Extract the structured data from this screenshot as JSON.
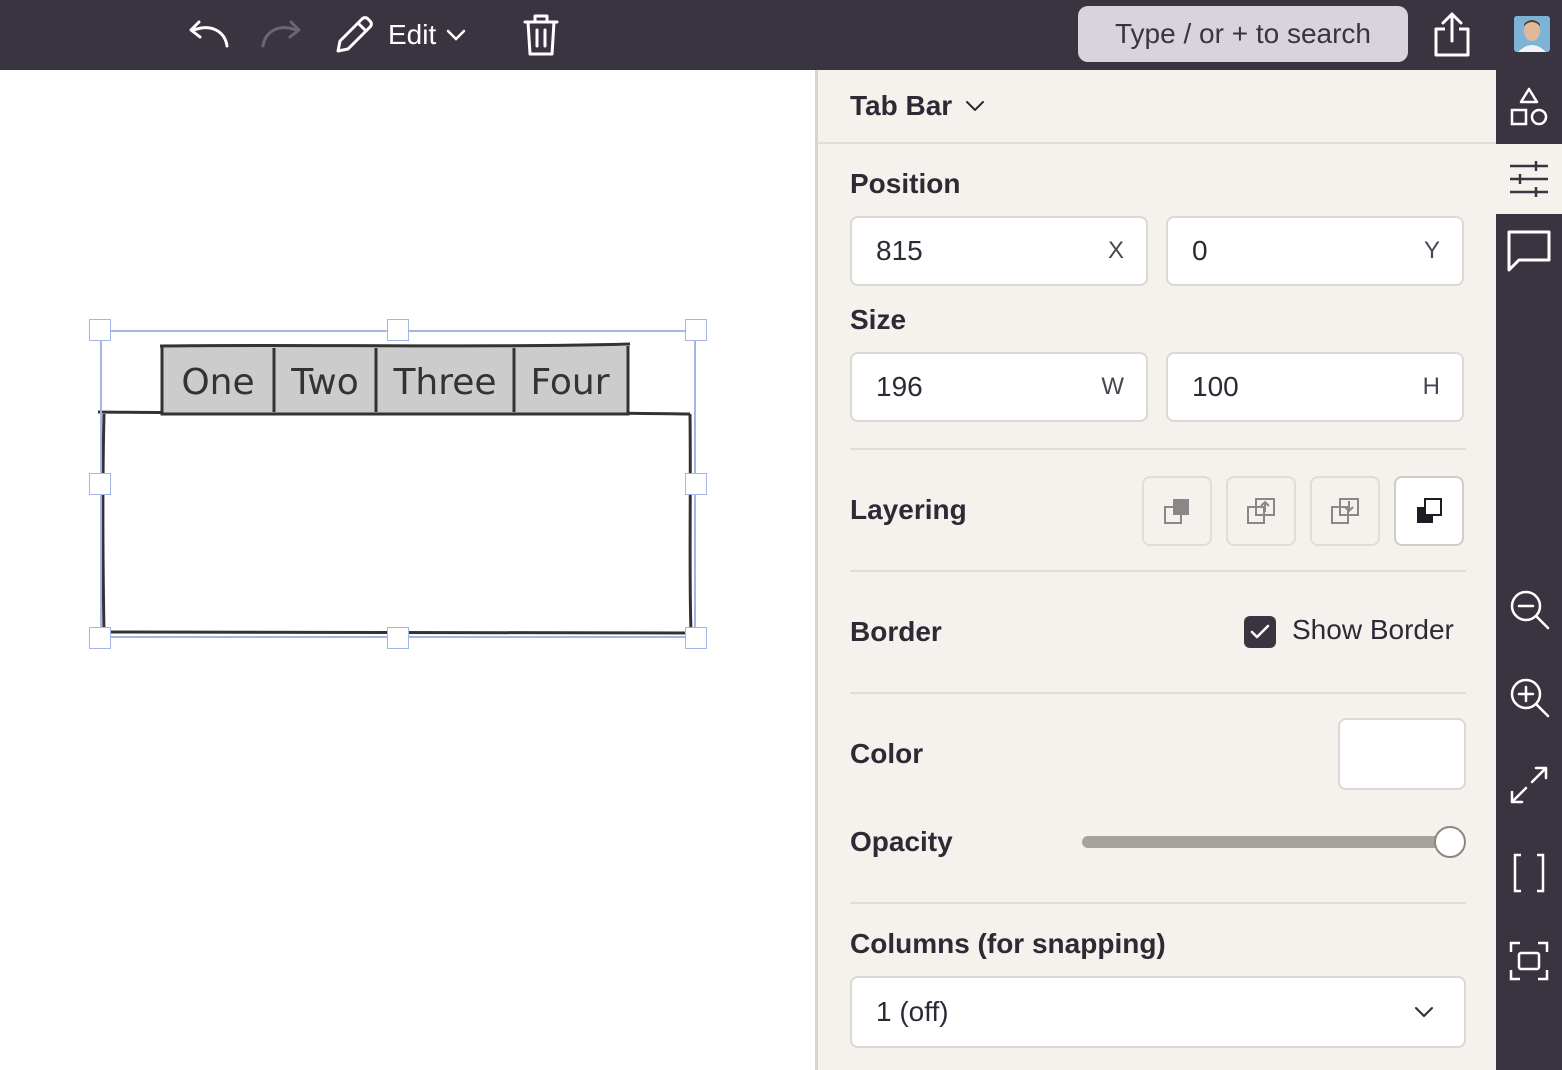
{
  "toolbar": {
    "edit_label": "Edit",
    "search_placeholder": "Type / or + to search"
  },
  "canvas": {
    "tab_bar": {
      "tabs": [
        "One",
        "Two",
        "Three",
        "Four"
      ]
    }
  },
  "panel": {
    "title": "Tab Bar",
    "position": {
      "label": "Position",
      "x": {
        "value": "815",
        "unit": "X"
      },
      "y": {
        "value": "0",
        "unit": "Y"
      }
    },
    "size": {
      "label": "Size",
      "w": {
        "value": "196",
        "unit": "W"
      },
      "h": {
        "value": "100",
        "unit": "H"
      }
    },
    "layering": {
      "label": "Layering"
    },
    "border": {
      "label": "Border",
      "show_border_label": "Show Border",
      "show_border_checked": true
    },
    "color": {
      "label": "Color",
      "value": "#ffffff"
    },
    "opacity": {
      "label": "Opacity",
      "value": 1.0
    },
    "columns": {
      "label": "Columns (for snapping)",
      "selected": "1 (off)"
    }
  },
  "colors": {
    "toolbar_bg": "#3a3440",
    "panel_bg": "#f5f1ec",
    "selection": "#a4b6e6",
    "tab_fill": "#cccccc"
  }
}
